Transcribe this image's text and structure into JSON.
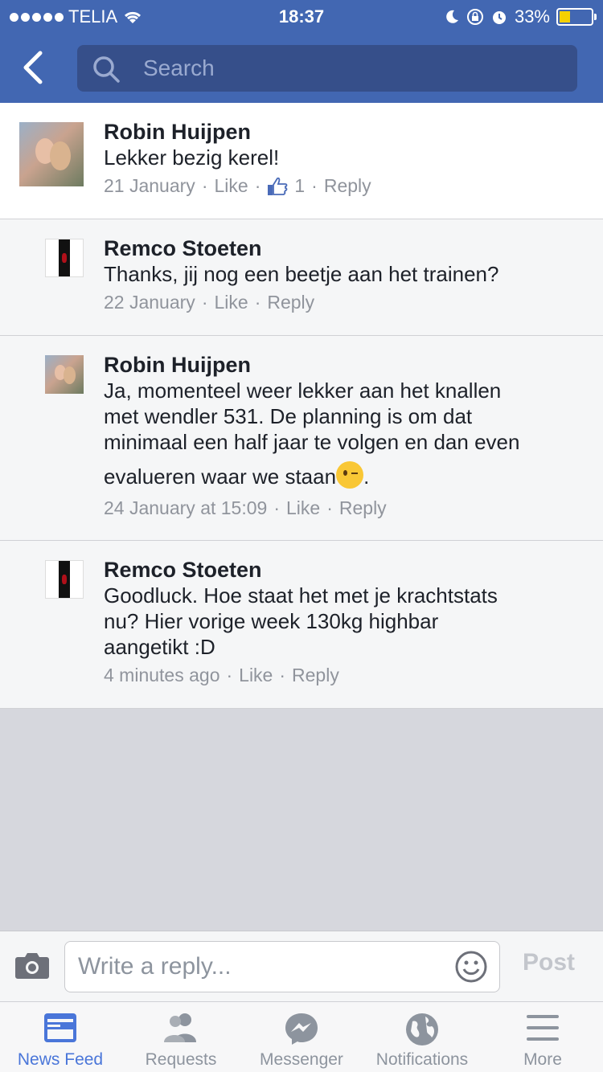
{
  "status_bar": {
    "carrier": "TELIA",
    "time": "18:37",
    "battery_percent": "33%",
    "battery_level": 0.33
  },
  "header": {
    "search_placeholder": "Search"
  },
  "comments": [
    {
      "author": "Robin Huijpen",
      "text": "Lekker bezig kerel!",
      "date": "21 January",
      "like_label": "Like",
      "like_count": "1",
      "reply_label": "Reply"
    },
    {
      "author": "Remco Stoeten",
      "text": "Thanks, jij nog een beetje aan het trainen?",
      "date": "22 January",
      "like_label": "Like",
      "reply_label": "Reply"
    },
    {
      "author": "Robin Huijpen",
      "text_lines": [
        "Ja, momenteel weer lekker aan het knallen",
        "met wendler 531. De planning is om dat",
        "minimaal een half jaar te volgen en dan even",
        "evalueren waar we staan"
      ],
      "text_end": ".",
      "date": "24 January at 15:09",
      "like_label": "Like",
      "reply_label": "Reply"
    },
    {
      "author": "Remco Stoeten",
      "text_lines": [
        "Goodluck. Hoe staat het met je krachtstats",
        "nu? Hier vorige week 130kg highbar",
        "aangetikt :D"
      ],
      "date": "4 minutes ago",
      "like_label": "Like",
      "reply_label": "Reply"
    }
  ],
  "composer": {
    "placeholder": "Write a reply...",
    "post_label": "Post"
  },
  "tabs": [
    {
      "label": "News Feed",
      "icon": "news-feed-icon",
      "active": true
    },
    {
      "label": "Requests",
      "icon": "requests-icon"
    },
    {
      "label": "Messenger",
      "icon": "messenger-icon"
    },
    {
      "label": "Notifications",
      "icon": "globe-icon"
    },
    {
      "label": "More",
      "icon": "menu-icon"
    }
  ],
  "colors": {
    "brand": "#4267b2",
    "active_tab": "#4a76d9",
    "muted": "#90949c"
  }
}
